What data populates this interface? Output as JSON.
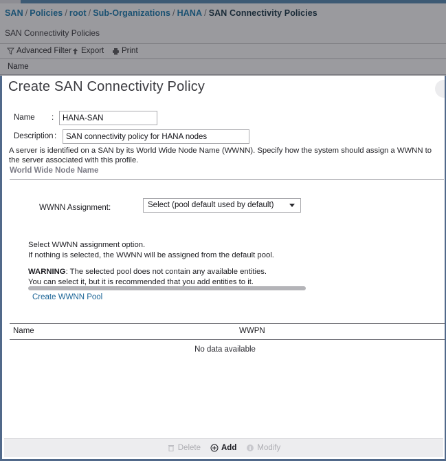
{
  "breadcrumb": {
    "items": [
      {
        "label": "SAN",
        "current": false
      },
      {
        "label": "Policies",
        "current": false
      },
      {
        "label": "root",
        "current": false
      },
      {
        "label": "Sub-Organizations",
        "current": false
      },
      {
        "label": "HANA",
        "current": false
      },
      {
        "label": "SAN Connectivity Policies",
        "current": true
      }
    ],
    "separator": "/"
  },
  "page": {
    "subtitle": "SAN Connectivity Policies"
  },
  "toolbar": {
    "advanced_filter": "Advanced Filter",
    "export": "Export",
    "print": "Print"
  },
  "list_header": {
    "name": "Name"
  },
  "dialog": {
    "title": "Create SAN Connectivity Policy",
    "close_icon": "close-circle-icon",
    "fields": {
      "name_label": "Name",
      "name_colon": ":",
      "name_value": "HANA-SAN",
      "name_placeholder": "",
      "description_label": "Description",
      "description_colon": ":",
      "description_value": "SAN connectivity policy for HANA nodes",
      "description_placeholder": ""
    },
    "helper_text": "A server is identified on a SAN by its World Wide Node Name (WWNN). Specify how the system should assign a WWNN to the server associated with this profile.",
    "section": {
      "heading": "World Wide Node Name"
    },
    "wwnn": {
      "label": "WWNN Assignment:",
      "selected": "Select (pool default used by default)",
      "options": [
        "Select (pool default used by default)"
      ],
      "create_pool_link": "Create WWNN Pool"
    },
    "notes": {
      "line1": "Select WWNN assignment option.",
      "line2": "If nothing is selected, the WWNN will be assigned from the default pool.",
      "warning_label": "WARNING",
      "warning_rest": ": The selected pool does not contain any available entities.",
      "warning_line2": "You can select it, but it is recommended that you add entities to it."
    },
    "table": {
      "columns": [
        "Name",
        "WWPN"
      ],
      "rows": [],
      "empty_text": "No data available"
    },
    "actions": [
      {
        "label": "Delete",
        "icon": "trash-icon",
        "enabled": false
      },
      {
        "label": "Add",
        "icon": "plus-circle-icon",
        "enabled": true
      },
      {
        "label": "Modify",
        "icon": "info-circle-icon",
        "enabled": false
      }
    ]
  },
  "colors": {
    "chrome_gray": "#9a9a9e",
    "dialog_border": "#51698a",
    "link_blue": "#1a6496",
    "breadcrumb_blue": "#1a5172",
    "action_bar_bg": "#ededef"
  }
}
